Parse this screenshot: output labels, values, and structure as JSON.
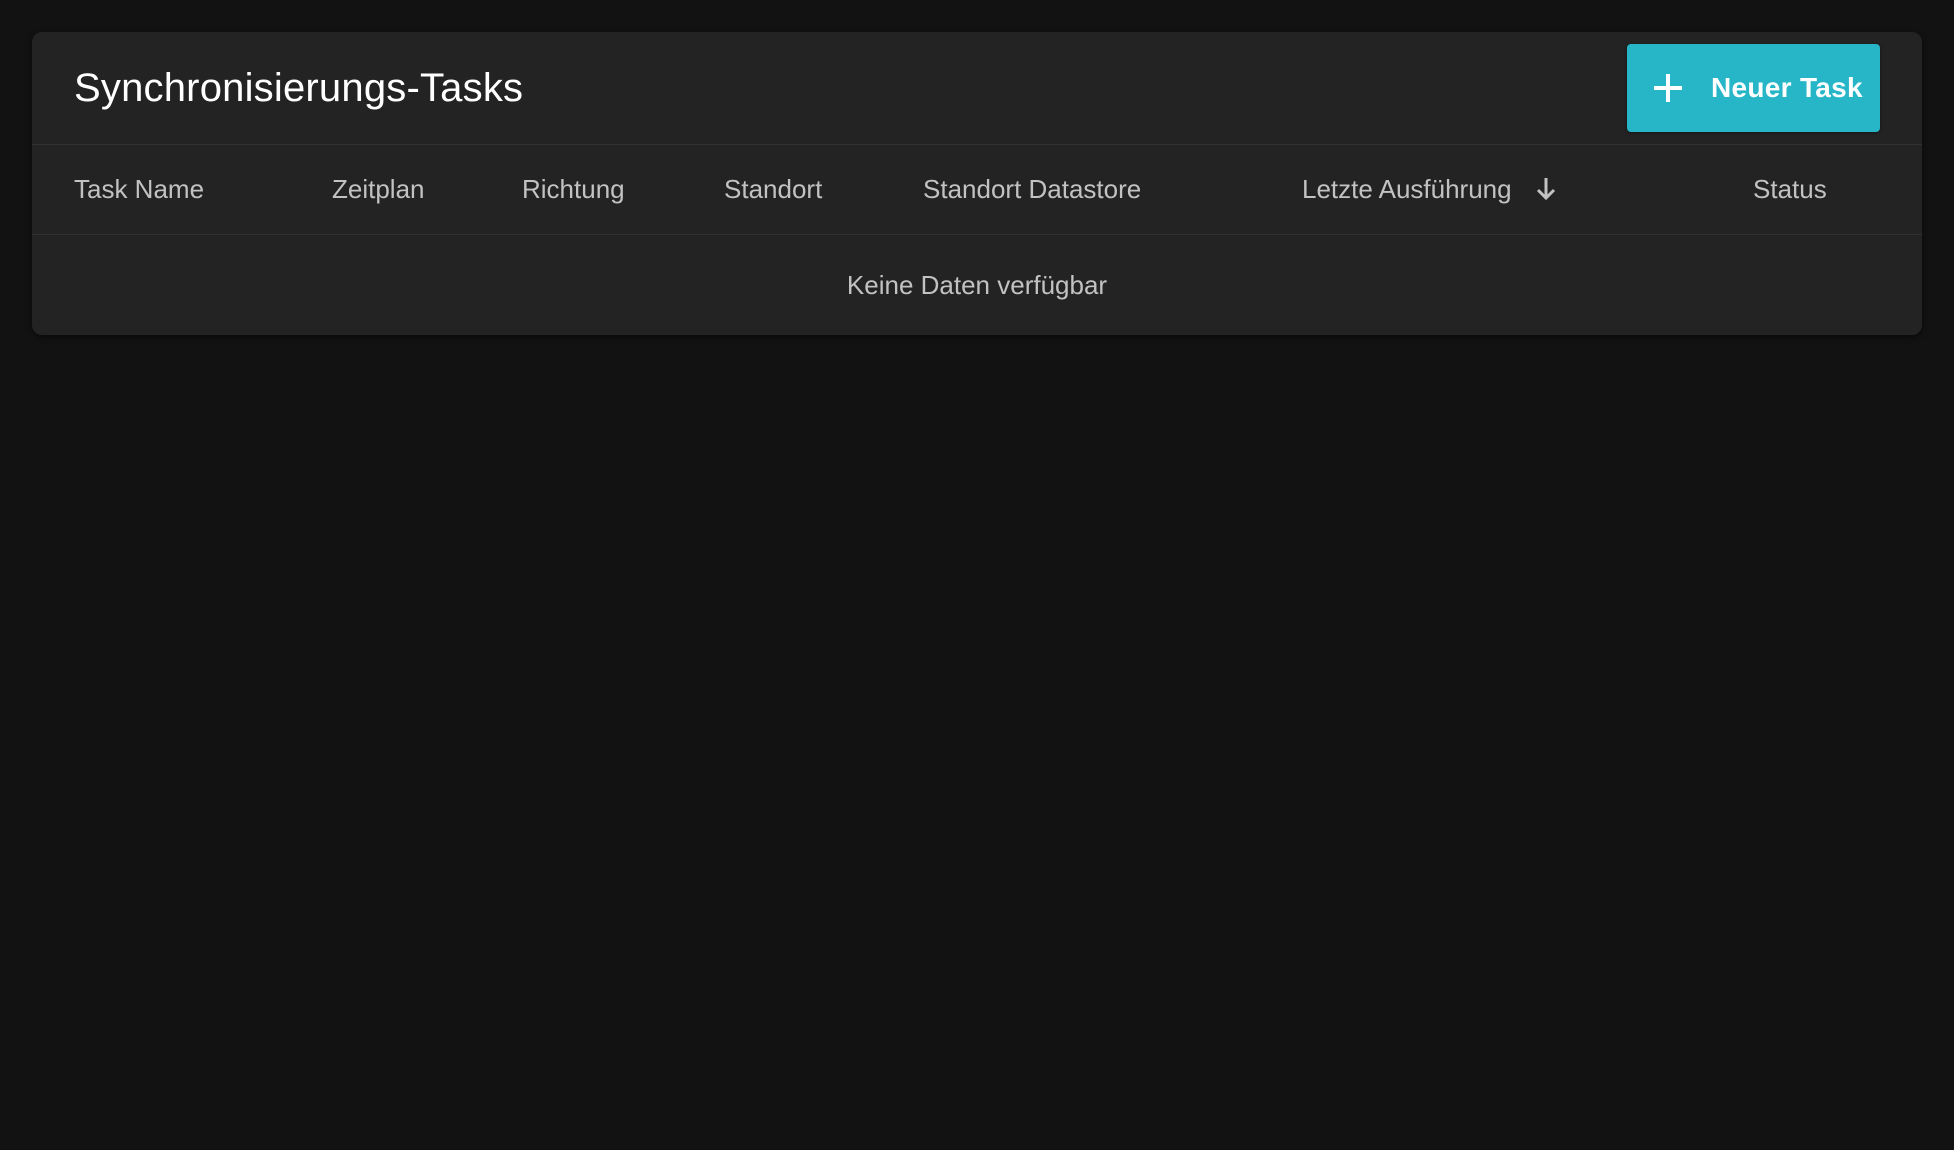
{
  "panel": {
    "title": "Synchronisierungs-Tasks",
    "new_task_button": {
      "label": "Neuer Task",
      "icon": "plus-icon"
    },
    "accent_color": "#26b6c8"
  },
  "table": {
    "columns": [
      {
        "label": "Task Name"
      },
      {
        "label": "Zeitplan"
      },
      {
        "label": "Richtung"
      },
      {
        "label": "Standort"
      },
      {
        "label": "Standort Datastore"
      },
      {
        "label": "Letzte Ausführung",
        "sorted": "descending",
        "sort_icon": "arrow-down-icon"
      },
      {
        "label": "Status"
      }
    ],
    "empty_message": "Keine Daten verfügbar"
  }
}
